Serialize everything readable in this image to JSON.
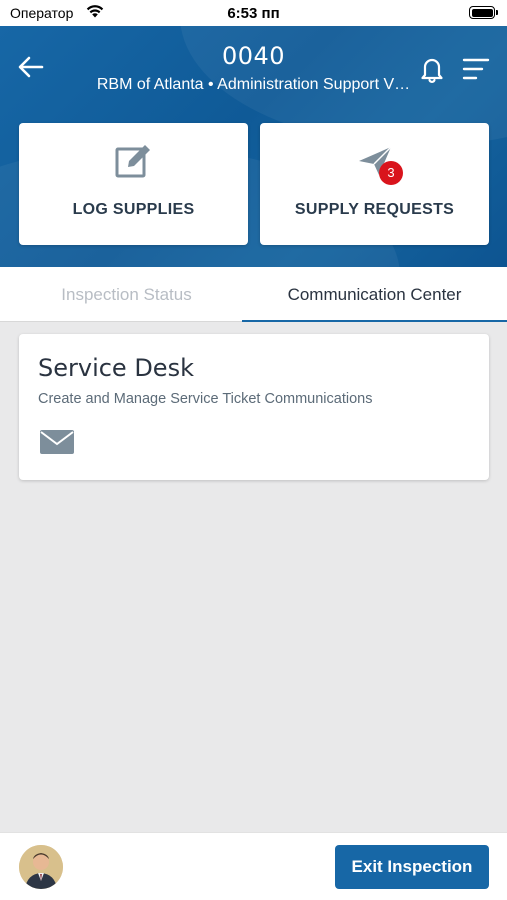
{
  "status_bar": {
    "carrier": "Оператор",
    "time": "6:53 пп"
  },
  "header": {
    "title": "0040",
    "subtitle": "RBM of Atlanta • Administration Support V…",
    "back_icon": "arrow-left-icon",
    "bell_icon": "bell-icon",
    "menu_icon": "menu-icon"
  },
  "actions": {
    "log_supplies": {
      "label": "LOG SUPPLIES",
      "icon": "edit-icon"
    },
    "supply_requests": {
      "label": "SUPPLY REQUESTS",
      "icon": "paper-plane-icon",
      "badge": "3"
    }
  },
  "tabs": [
    {
      "label": "Inspection Status",
      "active": false
    },
    {
      "label": "Communication Center",
      "active": true
    }
  ],
  "service_desk": {
    "title": "Service Desk",
    "description": "Create and Manage Service Ticket Communications",
    "icon": "envelope-icon"
  },
  "footer": {
    "exit_label": "Exit Inspection",
    "avatar": "user-avatar"
  },
  "colors": {
    "primary": "#1767a6",
    "badge": "#d9141c",
    "tab_inactive": "#b8bdc4",
    "icon_gray": "#7d8e9b"
  }
}
